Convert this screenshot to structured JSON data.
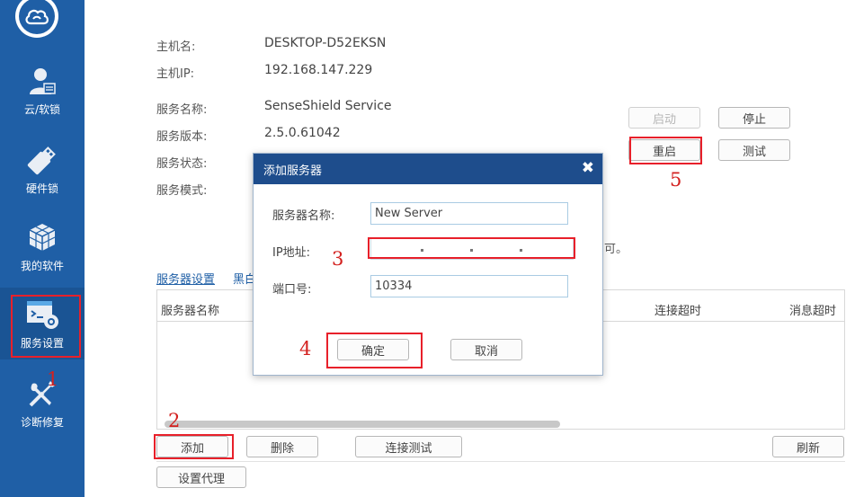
{
  "sidebar": {
    "items": [
      {
        "label": "云/软锁",
        "icon": "user-cloud-icon"
      },
      {
        "label": "硬件锁",
        "icon": "usb-key-icon"
      },
      {
        "label": "我的软件",
        "icon": "cubes-icon"
      },
      {
        "label": "服务设置",
        "icon": "service-settings-icon",
        "active": true
      },
      {
        "label": "诊断修复",
        "icon": "repair-tools-icon"
      }
    ]
  },
  "info": {
    "hostname_label": "主机名:",
    "hostname_value": "DESKTOP-D52EKSN",
    "host_ip_label": "主机IP:",
    "host_ip_value": "192.168.147.229",
    "service_name_label": "服务名称:",
    "service_name_value": "SenseShield Service",
    "service_version_label": "服务版本:",
    "service_version_value": "2.5.0.61042",
    "service_status_label": "服务状态:",
    "service_mode_label": "服务模式:"
  },
  "service_buttons": {
    "start": "启动",
    "stop": "停止",
    "restart": "重启",
    "test": "测试"
  },
  "note_tail": "可。",
  "tabs": {
    "server_settings": "服务器设置",
    "blacklist_partial": "黑白"
  },
  "table": {
    "columns": [
      "服务器名称",
      "连接超时",
      "消息超时"
    ]
  },
  "bottom_buttons": {
    "add": "添加",
    "delete": "删除",
    "connect_test": "连接测试",
    "refresh": "刷新",
    "proxy": "设置代理"
  },
  "dialog": {
    "title": "添加服务器",
    "close_glyph": "✖",
    "server_name_label": "服务器名称:",
    "server_name_value": "New Server",
    "ip_label": "IP地址:",
    "port_label": "端口号:",
    "port_value": "10334",
    "ok": "确定",
    "cancel": "取消"
  },
  "annotations": {
    "step1": "1",
    "step2": "2",
    "step3": "3",
    "step4": "4",
    "step5": "5"
  },
  "colors": {
    "sidebar": "#1f5fa6",
    "dialog_title": "#1e4d8c",
    "annotation_red": "#e8202a"
  }
}
